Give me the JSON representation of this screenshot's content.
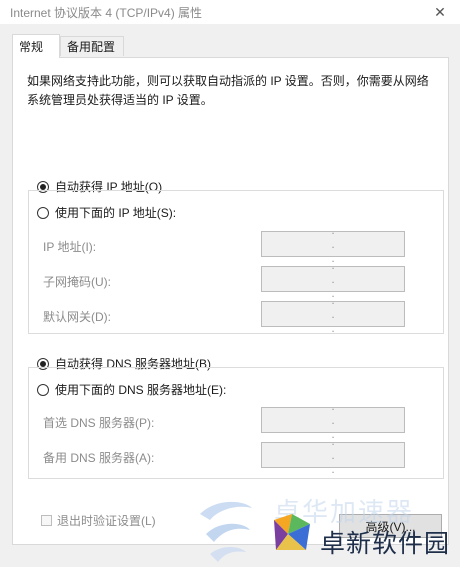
{
  "window": {
    "title": "Internet 协议版本 4 (TCP/IPv4) 属性",
    "close_glyph": "✕"
  },
  "tabs": [
    {
      "label": "常规",
      "active": true
    },
    {
      "label": "备用配置",
      "active": false
    }
  ],
  "description": "如果网络支持此功能，则可以获取自动指派的 IP 设置。否则，你需要从网络系统管理员处获得适当的 IP 设置。",
  "ip_section": {
    "auto_radio": {
      "label": "自动获得 IP 地址(O)",
      "checked": true
    },
    "manual_radio": {
      "label": "使用下面的 IP 地址(S):",
      "checked": false
    },
    "fields": [
      {
        "label": "IP 地址(I):",
        "value": ". . ."
      },
      {
        "label": "子网掩码(U):",
        "value": ". . ."
      },
      {
        "label": "默认网关(D):",
        "value": ". . ."
      }
    ]
  },
  "dns_section": {
    "auto_radio": {
      "label": "自动获得 DNS 服务器地址(B)",
      "checked": true
    },
    "manual_radio": {
      "label": "使用下面的 DNS 服务器地址(E):",
      "checked": false
    },
    "fields": [
      {
        "label": "首选 DNS 服务器(P):",
        "value": ". . ."
      },
      {
        "label": "备用 DNS 服务器(A):",
        "value": ". . ."
      }
    ]
  },
  "validate_checkbox": {
    "label": "退出时验证设置(L)",
    "checked": false,
    "enabled": false
  },
  "advanced_button": {
    "label": "高级(V)..."
  },
  "watermark": {
    "faint_text": "卓华加速器",
    "brand_text": "卓新软件园"
  },
  "colors": {
    "dialog_bg": "#f0f0f0",
    "panel_bg": "#ffffff",
    "disabled_text": "#8c8c8c",
    "logo_orange": "#f5a623",
    "logo_green": "#5cb85c",
    "logo_purple": "#7b3fa0",
    "logo_blue": "#3b6fd6"
  }
}
